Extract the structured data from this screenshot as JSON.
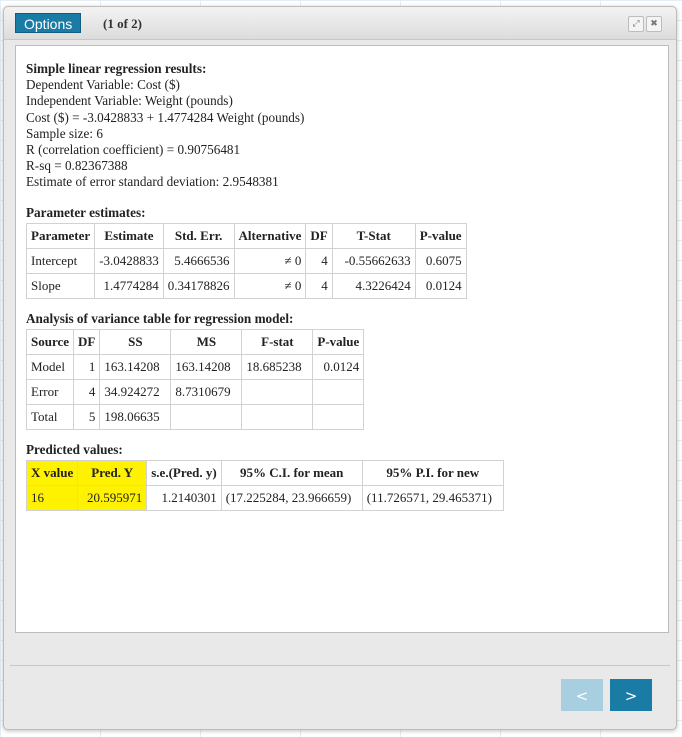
{
  "window": {
    "options_label": "Options",
    "page_indicator": "(1 of 2)",
    "expand_glyph": "⤢",
    "close_glyph": "✖"
  },
  "summary": {
    "heading": "Simple linear regression results:",
    "lines": [
      "Dependent Variable: Cost ($)",
      "Independent Variable: Weight (pounds)",
      "Cost ($) = -3.0428833 + 1.4774284 Weight (pounds)",
      "Sample size: 6",
      "R (correlation coefficient) = 0.90756481",
      "R-sq = 0.82367388",
      "Estimate of error standard deviation: 2.9548381"
    ]
  },
  "parameters": {
    "title": "Parameter estimates:",
    "headers": [
      "Parameter",
      "Estimate",
      "Std. Err.",
      "Alternative",
      "DF",
      "T-Stat",
      "P-value"
    ],
    "rows": [
      [
        "Intercept",
        "-3.0428833",
        "5.4666536",
        "≠ 0",
        "4",
        "-0.55662633",
        "0.6075"
      ],
      [
        "Slope",
        "1.4774284",
        "0.34178826",
        "≠ 0",
        "4",
        "4.3226424",
        "0.0124"
      ]
    ]
  },
  "anova": {
    "title": "Analysis of variance table for regression model:",
    "headers": [
      "Source",
      "DF",
      "SS",
      "MS",
      "F-stat",
      "P-value"
    ],
    "rows": [
      [
        "Model",
        "1",
        "163.14208",
        "163.14208",
        "18.685238",
        "0.0124"
      ],
      [
        "Error",
        "4",
        "34.924272",
        "8.7310679",
        "",
        ""
      ],
      [
        "Total",
        "5",
        "198.06635",
        "",
        "",
        ""
      ]
    ]
  },
  "predicted": {
    "title": "Predicted values:",
    "headers": [
      "X value",
      "Pred. Y",
      "s.e.(Pred. y)",
      "95% C.I. for mean",
      "95% P.I. for new"
    ],
    "rows": [
      [
        "16",
        "20.595971",
        "1.2140301",
        "(17.225284, 23.966659)",
        "(11.726571, 29.465371)"
      ]
    ],
    "highlight_color": "#fff200"
  },
  "nav": {
    "prev_label": "<",
    "next_label": ">"
  },
  "colors": {
    "accent": "#1a7ba5",
    "accent_disabled": "#a7cfe0"
  }
}
